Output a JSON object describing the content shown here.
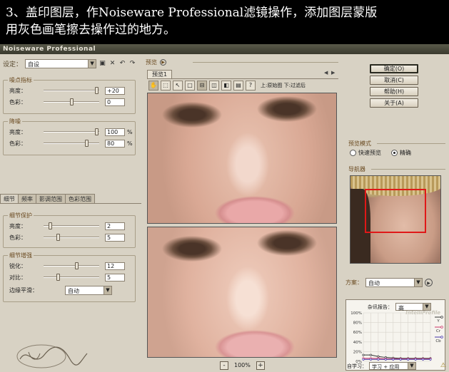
{
  "caption": {
    "line1": "3、盖印图层，作Noiseware Professional滤镜操作，添加图层蒙版",
    "line2": "用灰色画笔擦去操作过的地方。"
  },
  "window": {
    "title": "Noiseware Professional"
  },
  "left": {
    "preset_label": "设定：",
    "preset_value": "自设",
    "groups": [
      {
        "title": "噪点指标",
        "rows": [
          {
            "label": "亮度：",
            "value": "+20",
            "fraction": 0.98,
            "unit": ""
          },
          {
            "label": "色彩：",
            "value": "0",
            "fraction": 0.5,
            "unit": ""
          }
        ]
      },
      {
        "title": "降噪",
        "rows": [
          {
            "label": "亮度：",
            "value": "100",
            "fraction": 0.98,
            "unit": "%"
          },
          {
            "label": "色彩：",
            "value": "80",
            "fraction": 0.8,
            "unit": "%"
          }
        ]
      }
    ],
    "tabs": [
      "细节",
      "频率",
      "影调范围",
      "色彩范围"
    ],
    "detail_groups": [
      {
        "title": "细节保护",
        "rows": [
          {
            "label": "亮度：",
            "value": "2",
            "fraction": 0.1,
            "unit": ""
          },
          {
            "label": "色彩：",
            "value": "5",
            "fraction": 0.25,
            "unit": ""
          }
        ]
      },
      {
        "title": "细节增强",
        "rows": [
          {
            "label": "锐化：",
            "value": "12",
            "fraction": 0.6,
            "unit": ""
          },
          {
            "label": "对比：",
            "value": "5",
            "fraction": 0.25,
            "unit": ""
          }
        ]
      }
    ],
    "edge_label": "边缘平滑：",
    "edge_value": "自动"
  },
  "preview": {
    "header": "预览",
    "tab": "预览1",
    "toolbar_text": "上:原始图 下:过滤后",
    "zoom": "100%"
  },
  "right": {
    "buttons": [
      "确定(O)",
      "取消(C)",
      "帮助(H)",
      "关于(A)"
    ],
    "preview_mode_title": "预览模式",
    "radio_fast": "快速预览",
    "radio_accurate": "精确",
    "navigator_title": "导航器",
    "plan_label": "方案：",
    "plan_value": "自动",
    "chart_title": "杂讯报告：",
    "chart_level": "高",
    "brand": "IntelliProfile",
    "learn_label": "自学习：",
    "learn_value": "学习 + 应用"
  },
  "chart_data": {
    "type": "line",
    "title": "",
    "x": [
      1,
      2,
      3,
      4,
      5,
      6,
      7,
      8,
      9,
      10
    ],
    "ylim": [
      0,
      100
    ],
    "yticks": [
      "0%",
      "20%",
      "40%",
      "60%",
      "80%",
      "100%"
    ],
    "legend": [
      "Y",
      "Cr",
      "Cb"
    ],
    "series": [
      {
        "name": "Y",
        "color": "#333333",
        "values": [
          13,
          13,
          10,
          8,
          7,
          6,
          6,
          6,
          6,
          6
        ]
      },
      {
        "name": "Cr",
        "color": "#cc3366",
        "values": [
          6,
          6,
          6,
          5,
          5,
          5,
          5,
          5,
          5,
          5
        ]
      },
      {
        "name": "Cb",
        "color": "#4433aa",
        "values": [
          4,
          4,
          4,
          4,
          4,
          4,
          4,
          4,
          4,
          4
        ]
      }
    ]
  }
}
